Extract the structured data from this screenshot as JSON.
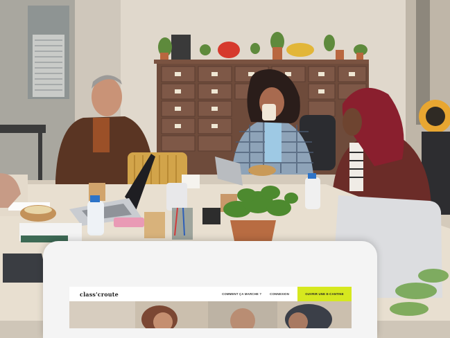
{
  "scene": {
    "description_free": true
  },
  "website": {
    "brand": "class'croute",
    "nav": [
      {
        "label": "COMMENT ÇA MARCHE ?"
      },
      {
        "label": "CONNEXION"
      }
    ],
    "cta_label": "OUVRIR UNE E-CANTINE"
  },
  "colors": {
    "cta": "#d6e81f",
    "wall": "#d9d2c5",
    "table": "#e8dfd0",
    "cabinet": "#6b4a3a"
  }
}
